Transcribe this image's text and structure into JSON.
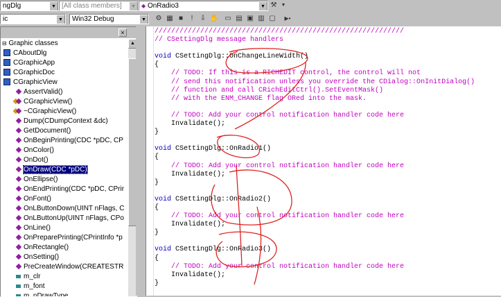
{
  "toolbar": {
    "class_combo": "ngDlg",
    "filter_combo": "[All class members]",
    "member_combo": "OnRadio3",
    "project_combo": "ic",
    "config_combo": "Win32 Debug"
  },
  "classview": {
    "root": "Graphic classes",
    "items": [
      {
        "label": "CAboutDlg",
        "kind": "class",
        "indent": 1
      },
      {
        "label": "CGraphicApp",
        "kind": "class",
        "indent": 1
      },
      {
        "label": "CGraphicDoc",
        "kind": "class",
        "indent": 1
      },
      {
        "label": "CGraphicView",
        "kind": "class",
        "indent": 1
      },
      {
        "label": "AssertValid()",
        "kind": "fn",
        "indent": 2
      },
      {
        "label": "CGraphicView()",
        "kind": "fnv",
        "indent": 2
      },
      {
        "label": "~CGraphicView()",
        "kind": "fnv",
        "indent": 2
      },
      {
        "label": "Dump(CDumpContext &dc)",
        "kind": "fn",
        "indent": 2
      },
      {
        "label": "GetDocument()",
        "kind": "fn",
        "indent": 2
      },
      {
        "label": "OnBeginPrinting(CDC *pDC, CP",
        "kind": "fn",
        "indent": 2
      },
      {
        "label": "OnColor()",
        "kind": "fn",
        "indent": 2
      },
      {
        "label": "OnDot()",
        "kind": "fn",
        "indent": 2
      },
      {
        "label": "OnDraw(CDC *pDC)",
        "kind": "fn",
        "indent": 2,
        "selected": true
      },
      {
        "label": "OnEllipse()",
        "kind": "fn",
        "indent": 2
      },
      {
        "label": "OnEndPrinting(CDC *pDC, CPrir",
        "kind": "fn",
        "indent": 2
      },
      {
        "label": "OnFont()",
        "kind": "fn",
        "indent": 2
      },
      {
        "label": "OnLButtonDown(UINT nFlags, C",
        "kind": "fn",
        "indent": 2
      },
      {
        "label": "OnLButtonUp(UINT nFlags, CPo",
        "kind": "fn",
        "indent": 2
      },
      {
        "label": "OnLine()",
        "kind": "fn",
        "indent": 2
      },
      {
        "label": "OnPreparePrinting(CPrintInfo *p",
        "kind": "fn",
        "indent": 2
      },
      {
        "label": "OnRectangle()",
        "kind": "fn",
        "indent": 2
      },
      {
        "label": "OnSetting()",
        "kind": "fn",
        "indent": 2
      },
      {
        "label": "PreCreateWindow(CREATESTR",
        "kind": "fn",
        "indent": 2
      },
      {
        "label": "m_clr",
        "kind": "var",
        "indent": 2
      },
      {
        "label": "m_font",
        "kind": "var",
        "indent": 2
      },
      {
        "label": "m_nDrawType",
        "kind": "var",
        "indent": 2
      }
    ]
  },
  "code": [
    [
      {
        "t": "////////////////////////////////////////////////////////////",
        "c": "cm"
      }
    ],
    [
      {
        "t": "// CSettingDlg message handlers",
        "c": "cm"
      }
    ],
    [],
    [
      {
        "t": "void",
        "c": "kw"
      },
      {
        "t": " CSettingDlg::OnChangeLineWidth()"
      }
    ],
    [
      {
        "t": "{"
      }
    ],
    [
      {
        "t": "    // TODO: If this is a RICHEDIT control, the control will not",
        "c": "cm"
      }
    ],
    [
      {
        "t": "    // send this notification unless you override the CDialog::OnInitDialog()",
        "c": "cm"
      }
    ],
    [
      {
        "t": "    // function and call CRichEditCtrl().SetEventMask()",
        "c": "cm"
      }
    ],
    [
      {
        "t": "    // with the ENM_CHANGE flag ORed into the mask.",
        "c": "cm"
      }
    ],
    [],
    [
      {
        "t": "    // TODO: Add your control notification handler code here",
        "c": "cm"
      }
    ],
    [
      {
        "t": "    Invalidate();"
      }
    ],
    [
      {
        "t": "}"
      }
    ],
    [],
    [
      {
        "t": "void",
        "c": "kw"
      },
      {
        "t": " CSettingDlg::OnRadio1()"
      }
    ],
    [
      {
        "t": "{"
      }
    ],
    [
      {
        "t": "    // TODO: Add your control notification handler code here",
        "c": "cm"
      }
    ],
    [
      {
        "t": "    Invalidate();"
      }
    ],
    [
      {
        "t": "}"
      }
    ],
    [],
    [
      {
        "t": "void",
        "c": "kw"
      },
      {
        "t": " CSettingDlg::OnRadio2()"
      }
    ],
    [
      {
        "t": "{"
      }
    ],
    [
      {
        "t": "    // TODO: Add your control notification handler code here",
        "c": "cm"
      }
    ],
    [
      {
        "t": "    Invalidate();"
      }
    ],
    [
      {
        "t": "}"
      }
    ],
    [],
    [
      {
        "t": "void",
        "c": "kw"
      },
      {
        "t": " CSettingDlg::OnRadio3()"
      }
    ],
    [
      {
        "t": "{"
      }
    ],
    [
      {
        "t": "    // TODO: Add your control notification handler code here",
        "c": "cm"
      }
    ],
    [
      {
        "t": "    Invalidate();"
      }
    ],
    [
      {
        "t": "}"
      }
    ]
  ],
  "colors": {
    "keyword": "#0000c0",
    "comment": "#c000c0",
    "selection": "#000080",
    "annotation": "#e02020"
  }
}
